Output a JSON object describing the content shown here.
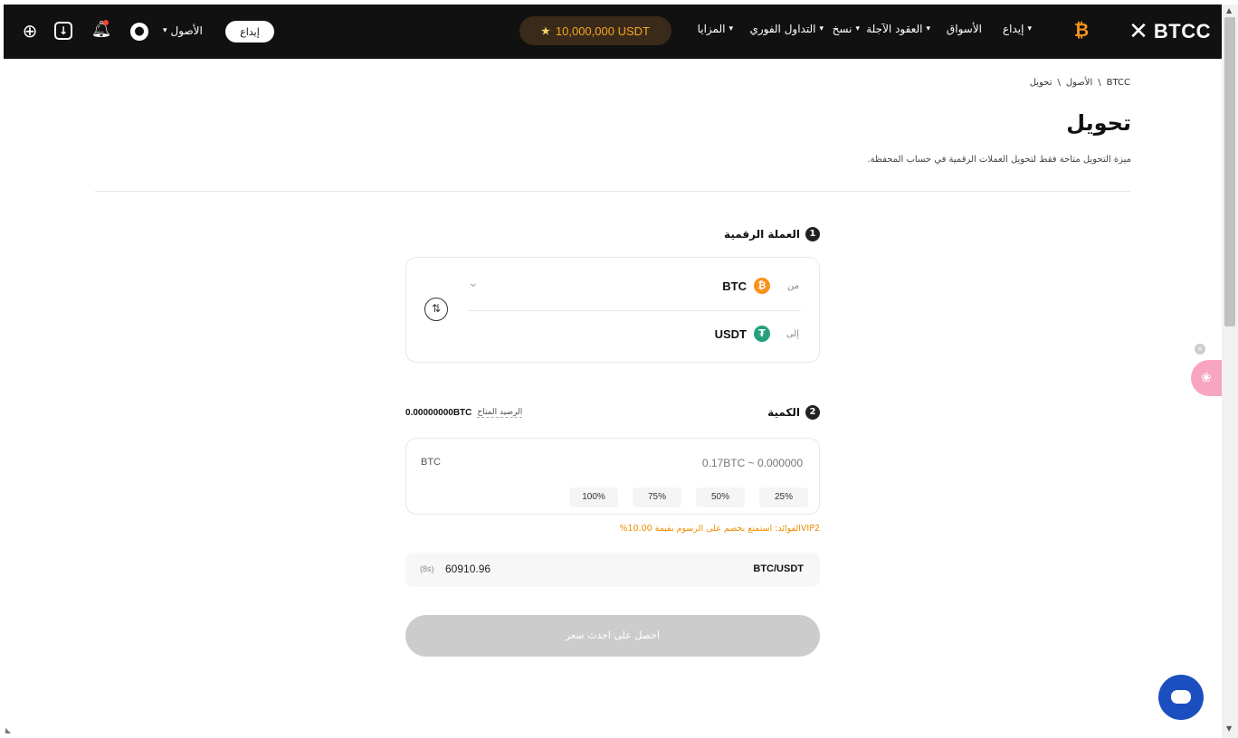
{
  "nav": {
    "logo_text": "BTCC",
    "items": [
      {
        "label": "إيداع",
        "has_caret": true
      },
      {
        "label": "الأسواق",
        "has_caret": false
      },
      {
        "label": "العقود الآجلة",
        "has_caret": true
      },
      {
        "label": "نسخ",
        "has_caret": true
      },
      {
        "label": "التداول الفوري",
        "has_caret": true
      },
      {
        "label": "المزايا",
        "has_caret": true
      }
    ],
    "promo_icon": "vip-badge-icon",
    "promo_text": "10,000,000 USDT",
    "deposit_button": "إيداع",
    "assets_menu": "الأصول",
    "caret": "▾"
  },
  "breadcrumb": [
    "BTCC",
    "\\",
    "الأصول",
    "\\",
    "تحويل"
  ],
  "page": {
    "title": "تحويل",
    "subtitle": "ميزة التحويل متاحة فقط لتحويل العملات الرقمية في حساب المحفظة."
  },
  "step1": {
    "number": "1",
    "label": "العملة الرقمية"
  },
  "conversion": {
    "from_label": "من",
    "from_symbol": "BTC",
    "from_icon_glyph": "₿",
    "from_color": "#f7931a",
    "to_label": "إلى",
    "to_symbol": "USDT",
    "to_icon_glyph": "₮",
    "to_color": "#26a17b"
  },
  "step2": {
    "number": "2",
    "label": "الكمية"
  },
  "balance": {
    "label": "الرصيد المتاح",
    "value": "0.00000000BTC"
  },
  "quantity": {
    "unit": "BTC",
    "placeholder": "0.17BTC ~ 0.000000",
    "percentages": [
      "100%",
      "75%",
      "50%",
      "25%"
    ]
  },
  "vip_note": "VIP2الفوائد: استمتع بخصم على الرسوم بقيمة 10.00%",
  "rate": {
    "timer": "(8s)",
    "value": "60910.96",
    "pair": "BTC/USDT"
  },
  "submit": {
    "label": "احصل على احدث سعر"
  }
}
